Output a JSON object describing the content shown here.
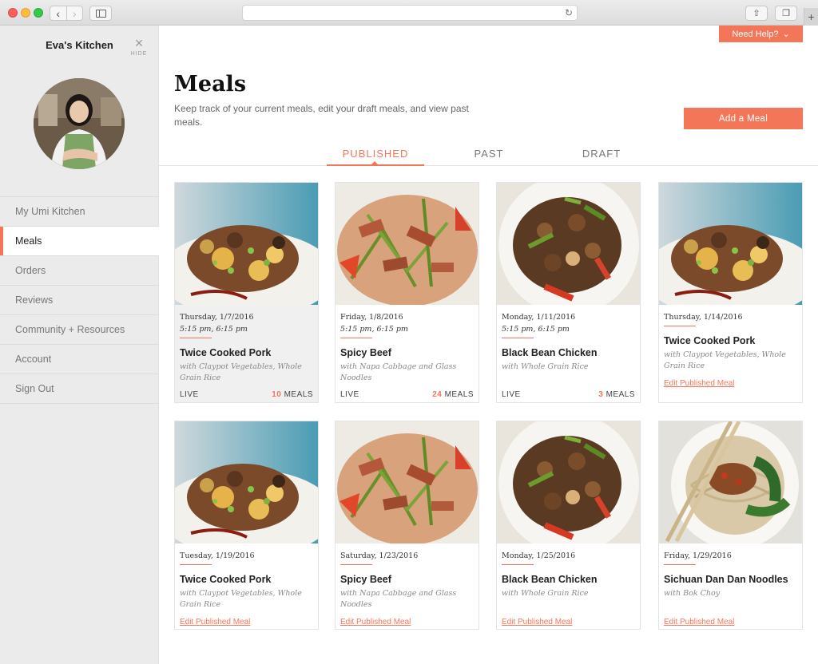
{
  "sidebar": {
    "kitchen_name": "Eva's Kitchen",
    "hide_label": "HIDE",
    "items": [
      {
        "label": "My Umi Kitchen"
      },
      {
        "label": "Meals"
      },
      {
        "label": "Orders"
      },
      {
        "label": "Reviews"
      },
      {
        "label": "Community + Resources"
      },
      {
        "label": "Account"
      },
      {
        "label": "Sign Out"
      }
    ],
    "active_item": "Meals"
  },
  "header": {
    "help_label": "Need Help?",
    "title": "Meals",
    "subtitle": "Keep track of your current meals, edit your draft meals, and view past meals.",
    "add_meal_label": "Add a Meal"
  },
  "tabs": [
    {
      "label": "PUBLISHED"
    },
    {
      "label": "PAST"
    },
    {
      "label": "DRAFT"
    }
  ],
  "active_tab": "PUBLISHED",
  "meals": [
    {
      "date": "Thursday, 1/7/2016",
      "time": "5:15 pm, 6:15 pm",
      "name": "Twice Cooked Pork",
      "sub": "with Claypot Vegetables, Whole Grain Rice",
      "status": "LIVE",
      "count": "10",
      "count_label": "MEALS",
      "edit": "",
      "photo": "pork"
    },
    {
      "date": "Friday, 1/8/2016",
      "time": "5:15 pm, 6:15 pm",
      "name": "Spicy Beef",
      "sub": "with Napa Cabbage and Glass Noodles",
      "status": "LIVE",
      "count": "24",
      "count_label": "MEALS",
      "edit": "",
      "photo": "beef"
    },
    {
      "date": "Monday, 1/11/2016",
      "time": "5:15 pm, 6:15 pm",
      "name": "Black Bean Chicken",
      "sub": "with Whole Grain Rice",
      "status": "LIVE",
      "count": "3",
      "count_label": "MEALS",
      "edit": "",
      "photo": "chicken"
    },
    {
      "date": "Thursday, 1/14/2016",
      "time": "",
      "name": "Twice Cooked Pork",
      "sub": "with Claypot Vegetables, Whole Grain Rice",
      "status": "",
      "count": "",
      "count_label": "",
      "edit": "Edit Published Meal",
      "photo": "pork"
    },
    {
      "date": "Tuesday, 1/19/2016",
      "time": "",
      "name": "Twice Cooked Pork",
      "sub": "with Claypot Vegetables, Whole Grain Rice",
      "status": "",
      "count": "",
      "count_label": "",
      "edit": "Edit Published Meal",
      "photo": "pork"
    },
    {
      "date": "Saturday, 1/23/2016",
      "time": "",
      "name": "Spicy Beef",
      "sub": "with Napa Cabbage and Glass Noodles",
      "status": "",
      "count": "",
      "count_label": "",
      "edit": "Edit Published Meal",
      "photo": "beef"
    },
    {
      "date": "Monday, 1/25/2016",
      "time": "",
      "name": "Black Bean Chicken",
      "sub": "with Whole Grain Rice",
      "status": "",
      "count": "",
      "count_label": "",
      "edit": "Edit Published Meal",
      "photo": "chicken"
    },
    {
      "date": "Friday, 1/29/2016",
      "time": "",
      "name": "Sichuan Dan Dan Noodles",
      "sub": "with Bok Choy",
      "status": "",
      "count": "",
      "count_label": "",
      "edit": "Edit Published Meal",
      "photo": "noodles"
    }
  ],
  "colors": {
    "accent": "#f47659",
    "sidebar_bg": "#ebebeb"
  }
}
